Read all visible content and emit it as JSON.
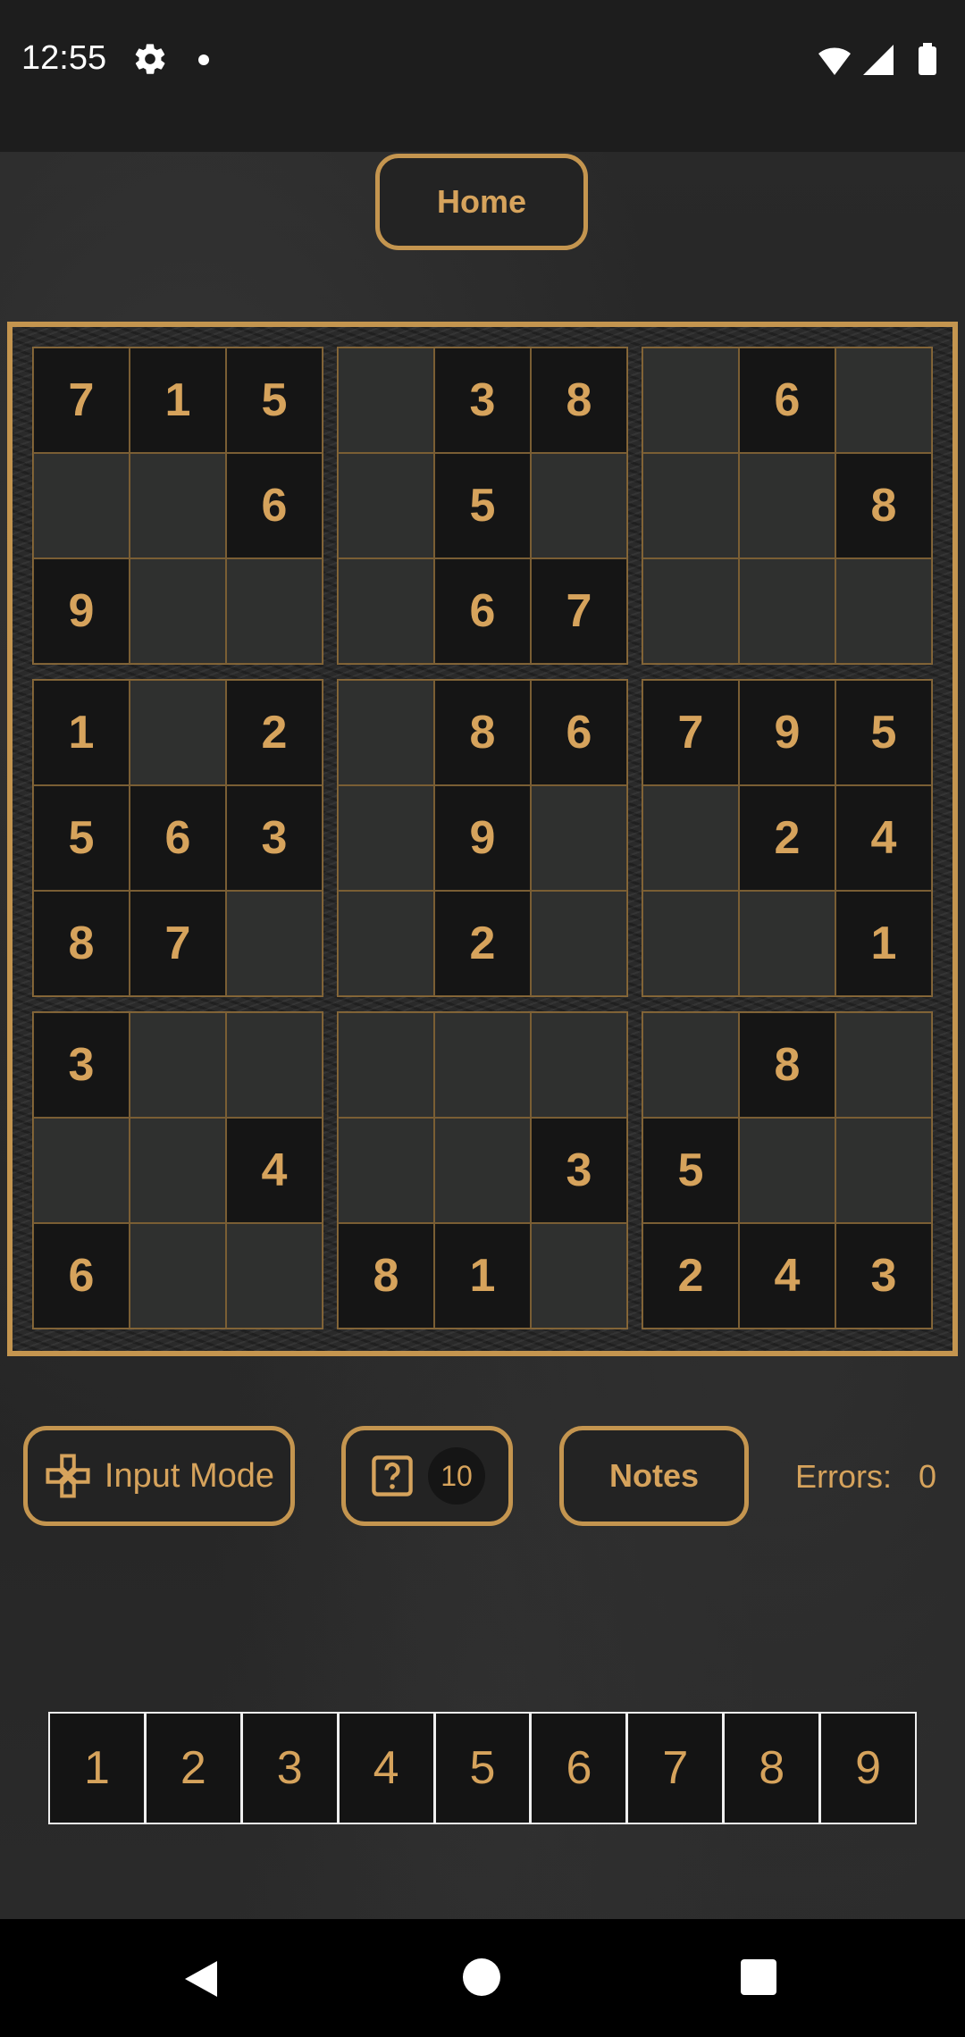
{
  "status": {
    "time": "12:55"
  },
  "header": {
    "home_label": "Home"
  },
  "board": {
    "grid": [
      [
        "7",
        "1",
        "5",
        "",
        "3",
        "8",
        "",
        "6",
        ""
      ],
      [
        "",
        "",
        "6",
        "",
        "5",
        "",
        "",
        "",
        "8"
      ],
      [
        "9",
        "",
        "",
        "",
        "6",
        "7",
        "",
        "",
        ""
      ],
      [
        "1",
        "",
        "2",
        "",
        "8",
        "6",
        "7",
        "9",
        "5"
      ],
      [
        "5",
        "6",
        "3",
        "",
        "9",
        "",
        "",
        "2",
        "4"
      ],
      [
        "8",
        "7",
        "",
        "",
        "2",
        "",
        "",
        "",
        "1"
      ],
      [
        "3",
        "",
        "",
        "",
        "",
        "",
        "",
        "8",
        ""
      ],
      [
        "",
        "",
        "4",
        "",
        "",
        "3",
        "5",
        "",
        ""
      ],
      [
        "6",
        "",
        "",
        "8",
        "1",
        "",
        "2",
        "4",
        "3"
      ]
    ]
  },
  "controls": {
    "input_mode_label": "Input Mode",
    "hint_count": "10",
    "notes_label": "Notes",
    "errors_label": "Errors:",
    "errors_value": "0"
  },
  "numpad": [
    "1",
    "2",
    "3",
    "4",
    "5",
    "6",
    "7",
    "8",
    "9"
  ],
  "colors": {
    "accent": "#c4954f",
    "digit": "#d6a35c",
    "given_bg": "#151515",
    "empty_bg": "#2f302f"
  }
}
